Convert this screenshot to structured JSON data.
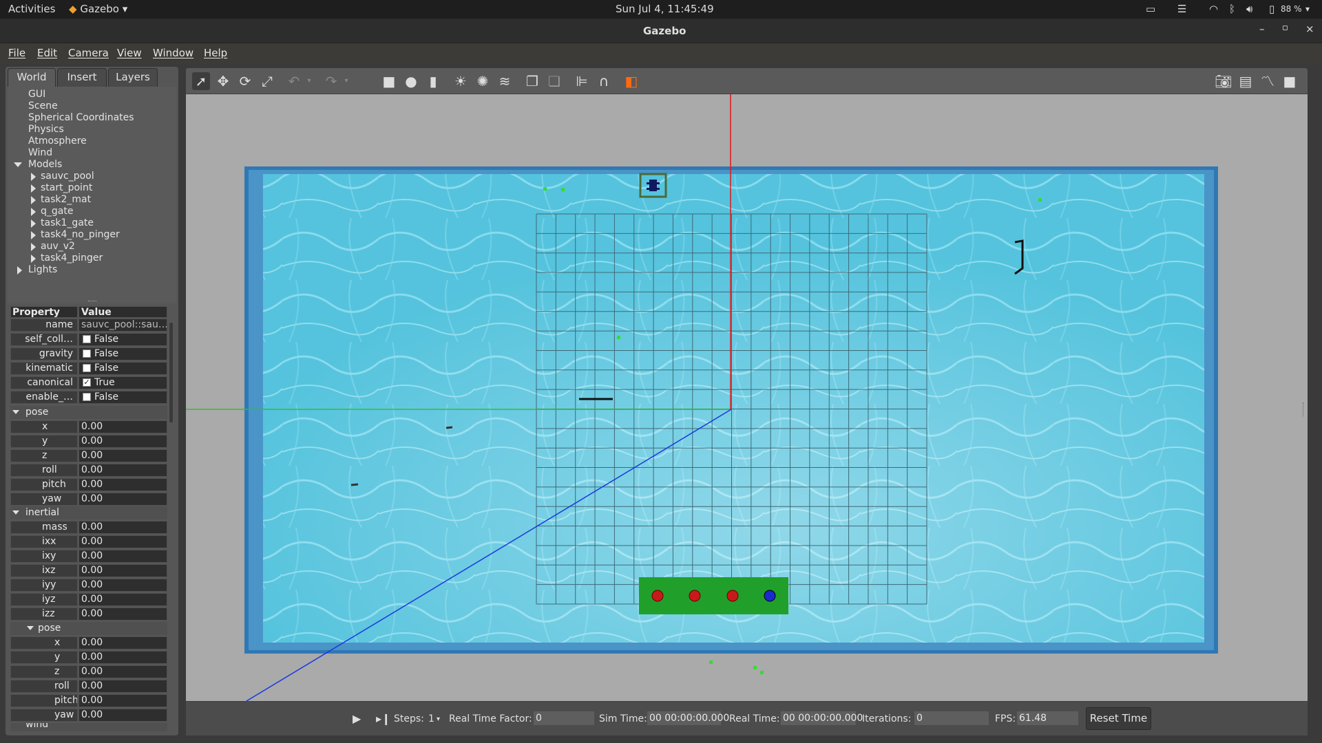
{
  "top_bar": {
    "activities": "Activities",
    "app": "Gazebo",
    "datetime": "Sun Jul  4, 11:45:49",
    "battery": "88 %"
  },
  "window": {
    "title": "Gazebo"
  },
  "menu": [
    "File",
    "Edit",
    "Camera",
    "View",
    "Window",
    "Help"
  ],
  "tabs": [
    "World",
    "Insert",
    "Layers"
  ],
  "world_tree": {
    "items": [
      "GUI",
      "Scene",
      "Spherical Coordinates",
      "Physics",
      "Atmosphere",
      "Wind"
    ],
    "models_label": "Models",
    "models": [
      "sauvc_pool",
      "start_point",
      "task2_mat",
      "q_gate",
      "task1_gate",
      "task4_no_pinger",
      "auv_v2",
      "task4_pinger"
    ],
    "lights_label": "Lights"
  },
  "properties": {
    "header_property": "Property",
    "header_value": "Value",
    "rows": [
      {
        "name": "name",
        "value": "sauvc_pool::sau…"
      },
      {
        "name": "self_coll…",
        "value": "False",
        "checked": false
      },
      {
        "name": "gravity",
        "value": "False",
        "checked": false
      },
      {
        "name": "kinematic",
        "value": "False",
        "checked": false
      },
      {
        "name": "canonical",
        "value": "True",
        "checked": true
      },
      {
        "name": "enable_…",
        "value": "False",
        "checked": false
      }
    ],
    "pose_label": "pose",
    "pose": [
      {
        "name": "x",
        "value": "0.00"
      },
      {
        "name": "y",
        "value": "0.00"
      },
      {
        "name": "z",
        "value": "0.00"
      },
      {
        "name": "roll",
        "value": "0.00"
      },
      {
        "name": "pitch",
        "value": "0.00"
      },
      {
        "name": "yaw",
        "value": "0.00"
      }
    ],
    "inertial_label": "inertial",
    "inertial": [
      {
        "name": "mass",
        "value": "0.00"
      },
      {
        "name": "ixx",
        "value": "0.00"
      },
      {
        "name": "ixy",
        "value": "0.00"
      },
      {
        "name": "ixz",
        "value": "0.00"
      },
      {
        "name": "iyy",
        "value": "0.00"
      },
      {
        "name": "iyz",
        "value": "0.00"
      },
      {
        "name": "izz",
        "value": "0.00"
      }
    ],
    "inertial_pose_label": "pose",
    "inertial_pose": [
      {
        "name": "x",
        "value": "0.00"
      },
      {
        "name": "y",
        "value": "0.00"
      },
      {
        "name": "z",
        "value": "0.00"
      },
      {
        "name": "roll",
        "value": "0.00"
      },
      {
        "name": "pitch",
        "value": "0.00"
      },
      {
        "name": "yaw",
        "value": "0.00"
      }
    ],
    "wind_label": "wind"
  },
  "bottom": {
    "steps_label": "Steps:",
    "steps_value": "1",
    "rtf_label": "Real Time Factor:",
    "rtf_value": "0",
    "sim_label": "Sim Time:",
    "sim_value": "00 00:00:00.000",
    "real_label": "Real Time:",
    "real_value": "00 00:00:00.000",
    "iter_label": "Iterations:",
    "iter_value": "0",
    "fps_label": "FPS:",
    "fps_value": "61.48",
    "reset_label": "Reset Time"
  },
  "colors": {
    "water": "#58c7e0",
    "pool_rim": "#2f78b4",
    "mat": "#20a02a",
    "ball_red": "#c81a1a",
    "ball_blue": "#1a2ad0",
    "marker": "#33dd33"
  }
}
